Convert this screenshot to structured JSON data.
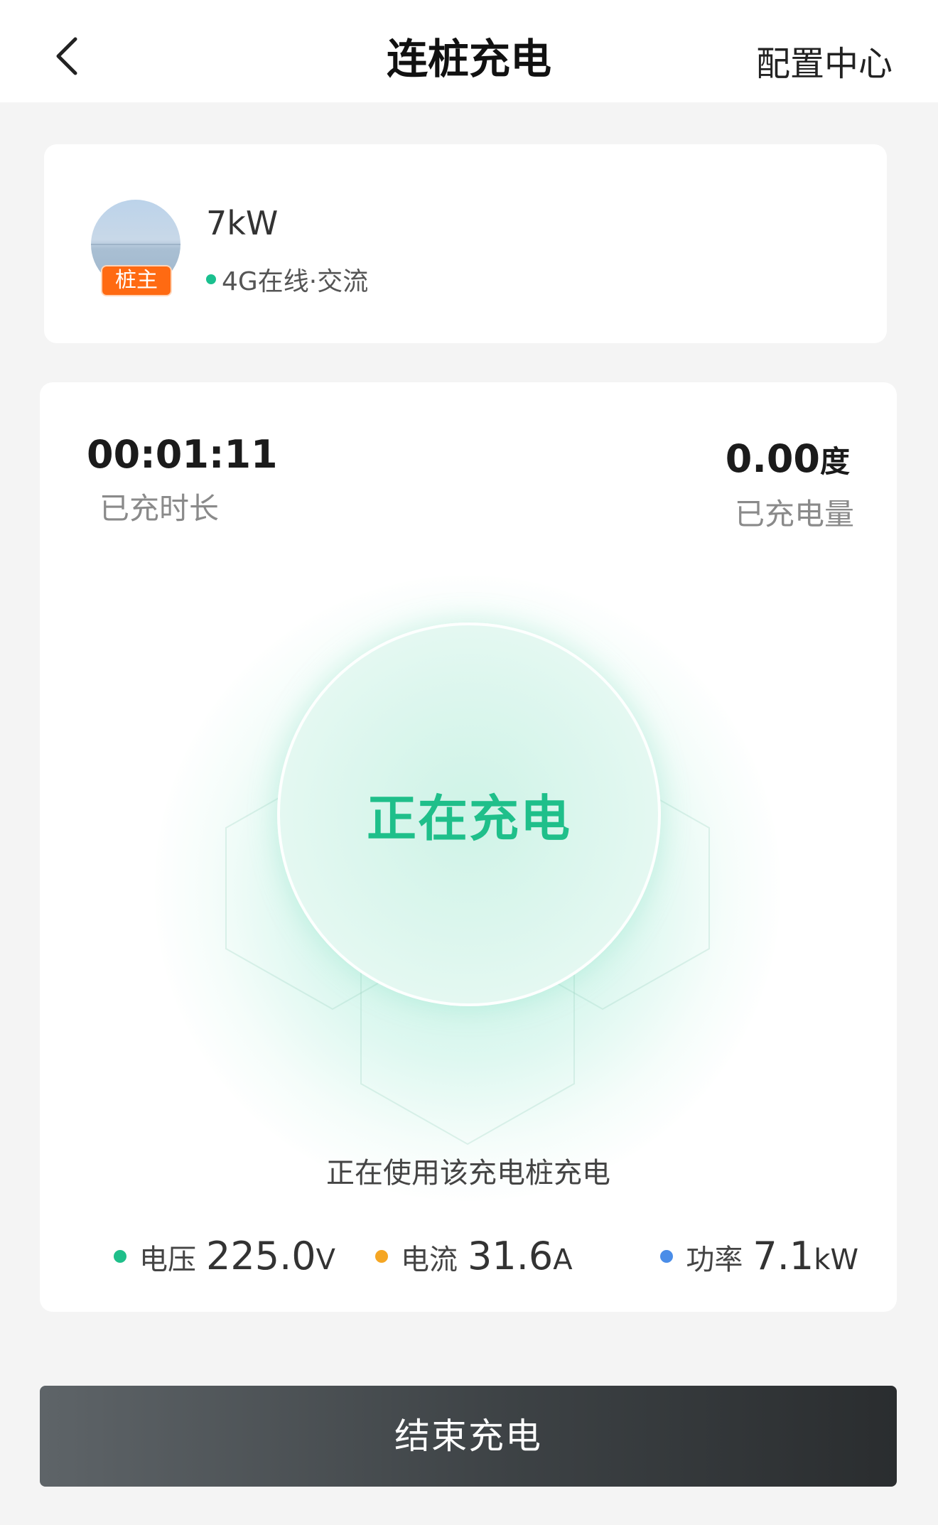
{
  "header": {
    "back_icon": "chevron-left-icon",
    "title": "连桩充电",
    "config_label": "配置中心"
  },
  "station": {
    "name": "7kW",
    "badge": "桩主",
    "status_text": "4G在线·交流",
    "status_color": "#1ac08f"
  },
  "session": {
    "duration_value": "00:01:11",
    "duration_label": "已充时长",
    "energy_value": "0.00",
    "energy_unit": "度",
    "energy_label": "已充电量",
    "state_text": "正在充电",
    "usage_note": "正在使用该充电桩充电"
  },
  "metrics": {
    "voltage": {
      "label": "电压",
      "value": "225.0",
      "unit": "V",
      "color": "#1fbf8a"
    },
    "current": {
      "label": "电流",
      "value": "31.6",
      "unit": "A",
      "color": "#f5a623"
    },
    "power": {
      "label": "功率",
      "value": "7.1",
      "unit": "kW",
      "color": "#4a8de8"
    }
  },
  "actions": {
    "stop_label": "结束充电"
  },
  "colors": {
    "accent": "#1fbf8a",
    "badge": "#ff6a12",
    "button": "#3d4245"
  }
}
